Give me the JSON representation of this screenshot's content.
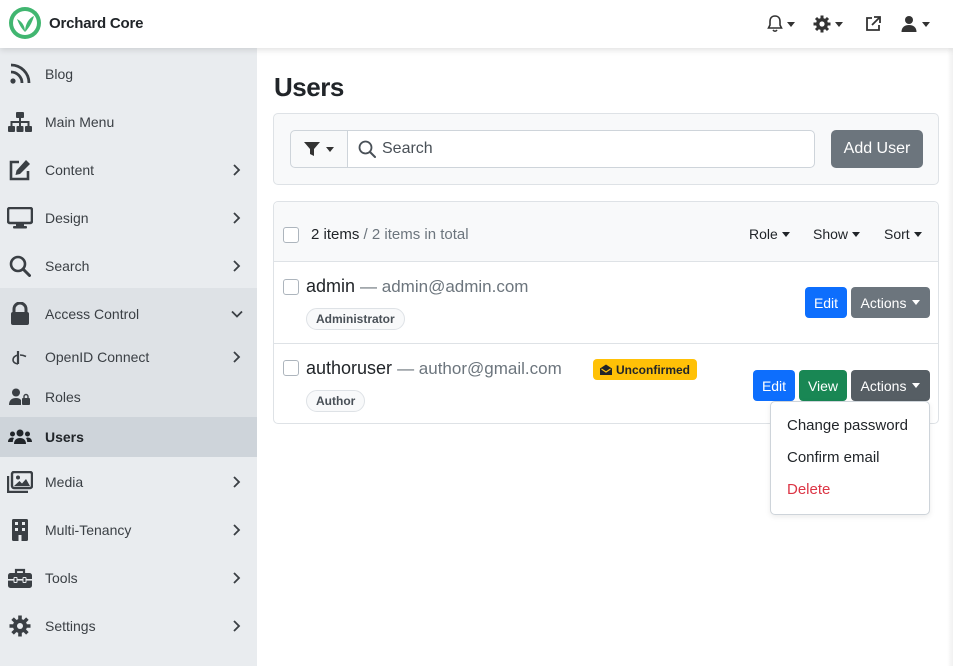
{
  "brand": {
    "name": "Orchard Core"
  },
  "colors": {
    "brand_green": "#41b670",
    "primary": "#0d6efd",
    "success": "#198754",
    "secondary": "#6c757d",
    "warning": "#ffc107",
    "danger": "#dc3545"
  },
  "topbar": {
    "icons": [
      "bell-icon",
      "gear-icon",
      "external-link-icon",
      "user-icon"
    ]
  },
  "sidebar": {
    "items": [
      {
        "label": "Blog",
        "icon": "rss-icon"
      },
      {
        "label": "Main Menu",
        "icon": "sitemap-icon"
      },
      {
        "label": "Content",
        "icon": "edit-icon"
      },
      {
        "label": "Design",
        "icon": "monitor-icon"
      },
      {
        "label": "Search",
        "icon": "search-icon"
      },
      {
        "label": "Access Control",
        "icon": "lock-icon"
      },
      {
        "label": "OpenID Connect",
        "icon": "openid-icon"
      },
      {
        "label": "Roles",
        "icon": "user-lock-icon"
      },
      {
        "label": "Users",
        "icon": "users-icon"
      },
      {
        "label": "Media",
        "icon": "images-icon"
      },
      {
        "label": "Multi-Tenancy",
        "icon": "building-icon"
      },
      {
        "label": "Tools",
        "icon": "toolbox-icon"
      },
      {
        "label": "Settings",
        "icon": "cog-icon"
      }
    ]
  },
  "page": {
    "title": "Users"
  },
  "filters": {
    "search_placeholder": "Search",
    "add_user_label": "Add User"
  },
  "list": {
    "count": "2 items",
    "total": " / 2 items in total",
    "dropdowns": {
      "role": "Role",
      "show": "Show",
      "sort": "Sort"
    },
    "users": [
      {
        "name": "admin",
        "email": "— admin@admin.com",
        "role": "Administrator",
        "edit_label": "Edit",
        "actions_label": "Actions"
      },
      {
        "name": "authoruser",
        "email": "— author@gmail.com",
        "role": "Author",
        "badge": "Unconfirmed",
        "edit_label": "Edit",
        "view_label": "View",
        "actions_label": "Actions"
      }
    ]
  },
  "actions_menu": {
    "items": [
      "Change password",
      "Confirm email",
      "Delete"
    ]
  }
}
